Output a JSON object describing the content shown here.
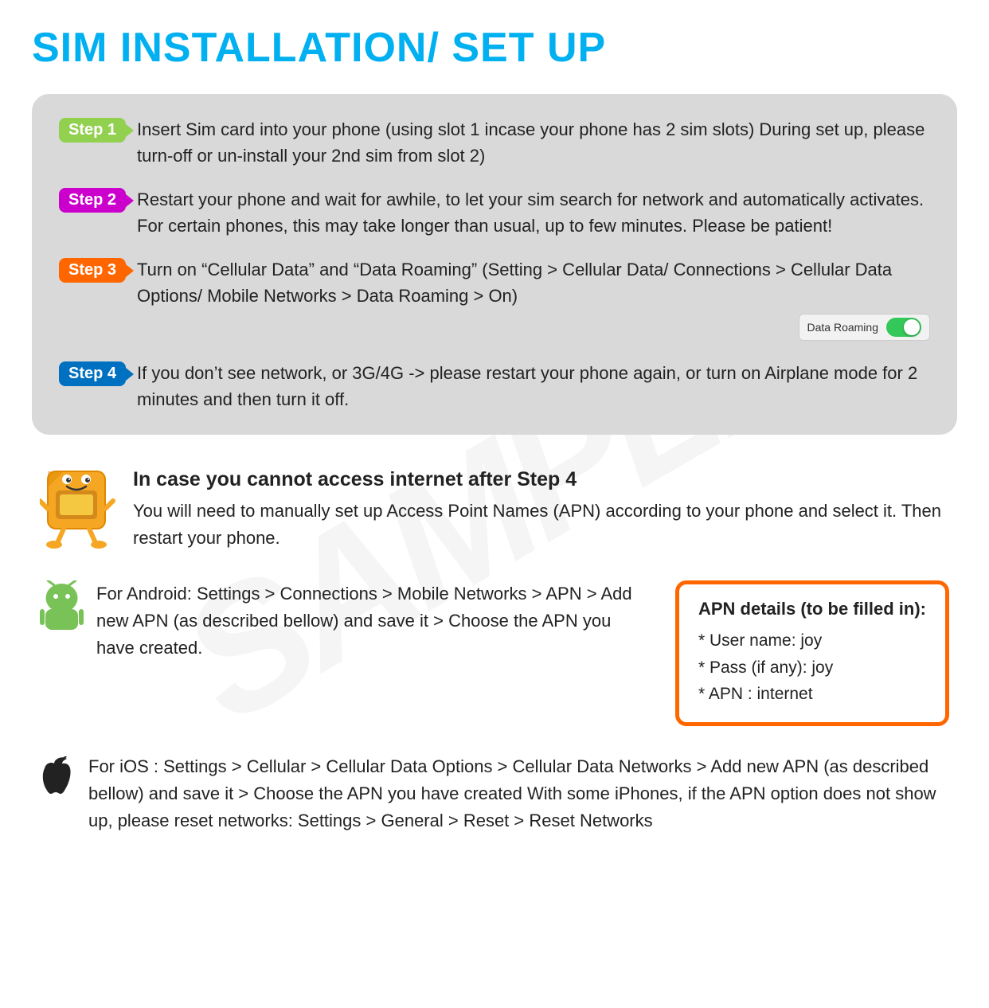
{
  "page": {
    "title": "SIM INSTALLATION/ SET UP",
    "watermark": "SAMPLE",
    "steps_card": {
      "step1": {
        "badge": "Step 1",
        "text": "Insert Sim card into your phone (using slot 1 incase your phone has 2 sim slots) During set up, please turn-off or un-install your 2nd sim from slot 2)"
      },
      "step2": {
        "badge": "Step 2",
        "text": "Restart your phone and wait for awhile, to let your sim search for network and  automatically  activates.  For  certain  phones,  this  may  take  longer  than usual, up to few minutes. Please be patient!"
      },
      "step3": {
        "badge": "Step 3",
        "text": "Turn  on “Cellular  Data”  and  “Data  Roaming”  (Setting  >  Cellular  Data/ Connections > Cellular Data Options/ Mobile Networks > Data Roaming > On)"
      },
      "step4": {
        "badge": "Step 4",
        "text": "If you don’t see network, or 3G/4G -> please restart your phone again, or turn on Airplane mode for 2 minutes and then turn it off."
      },
      "data_roaming_label": "Data Roaming"
    },
    "sim_section": {
      "heading": "In case you cannot access internet after Step 4",
      "body": "You will need to manually set up Access Point Names (APN) according to your phone  and select it. Then restart your phone."
    },
    "android_section": {
      "text": "For Android: Settings > Connections > Mobile Networks >  APN > Add new APN  (as described bellow) and save it  > Choose the APN you have created."
    },
    "apn_box": {
      "title": "APN details (to be filled in):",
      "line1": "* User name: joy",
      "line2": "* Pass (if any): joy",
      "line3": "* APN : internet"
    },
    "ios_section": {
      "text": "For iOS : Settings > Cellular > Cellular Data Options > Cellular Data Networks > Add new APN  (as described bellow) and save it  > Choose the APN you have created With some iPhones, if the APN option does not show up, please reset networks: Settings > General >  Reset > Reset Networks"
    }
  }
}
